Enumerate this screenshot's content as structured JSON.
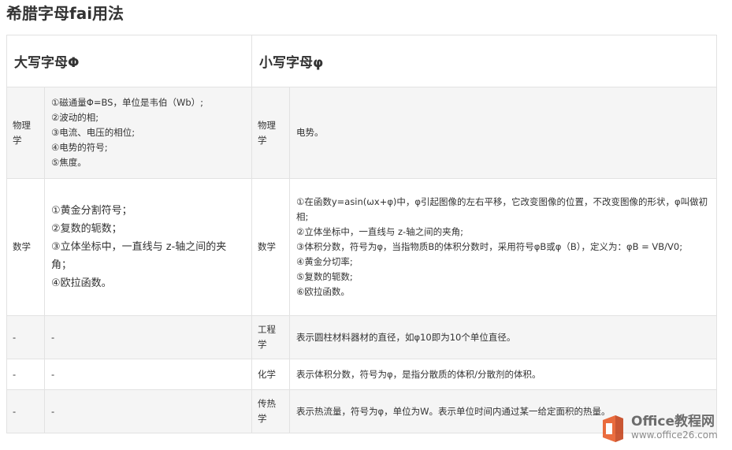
{
  "page_title": "希腊字母fai用法",
  "headers": {
    "upper": "大写字母Φ",
    "lower": "小写字母φ"
  },
  "rows": [
    {
      "upper_category": "物理学",
      "upper_text": "①磁通量Φ=BS，单位是韦伯（Wb）;\n②波动的相;\n③电流、电压的相位;\n④电势的符号;\n⑤焦度。",
      "lower_category": "物理学",
      "lower_text": "电势。"
    },
    {
      "upper_category": "数学",
      "upper_text": "①黄金分割符号；\n②复数的轭数；\n③立体坐标中，一直线与 z-轴之间的夹角；\n④欧拉函数。",
      "lower_category": "数学",
      "lower_text": "①在函数y=asin(ωx+φ)中，φ引起图像的左右平移，它改变图像的位置，不改变图像的形状，φ叫做初相;\n②立体坐标中，一直线与 z-轴之间的夹角;\n③体积分数，符号为φ，当指物质B的体积分数时，采用符号φB或φ（B），定义为：φB = VB/V0;\n④黄金分切率;\n⑤复数的轭数;\n⑥欧拉函数。"
    },
    {
      "upper_category": "-",
      "upper_text": "-",
      "lower_category": "工程学",
      "lower_text": "表示圆柱材料器材的直径，如φ10即为10个单位直径。"
    },
    {
      "upper_category": "-",
      "upper_text": "-",
      "lower_category": "化学",
      "lower_text": "表示体积分数，符号为φ，是指分散质的体积/分散剂的体积。"
    },
    {
      "upper_category": "-",
      "upper_text": "-",
      "lower_category": "传热学",
      "lower_text": "表示热流量，符号为φ，单位为W。表示单位时间内通过某一给定面积的热量。"
    }
  ],
  "watermark": {
    "name": "Office教程网",
    "url": "www.office26.com",
    "icon": "office-logo-icon"
  }
}
